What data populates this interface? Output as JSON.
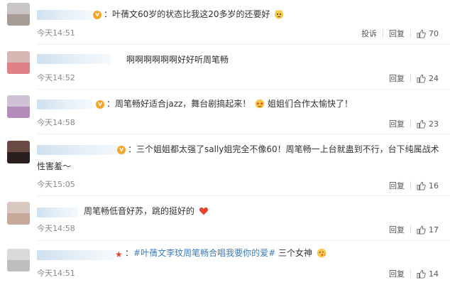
{
  "comments": [
    {
      "has_v": true,
      "text": "叶蒨文60岁的状态比我这20多岁的还要好",
      "emoji": "cat-emoji",
      "time": "今天14:51",
      "actions": [
        "投诉",
        "回复"
      ],
      "likes": "70"
    },
    {
      "has_v": false,
      "text": "啊啊啊啊啊啊好好听周笔畅",
      "time": "今天14:52",
      "actions": [
        "回复"
      ],
      "likes": "24"
    },
    {
      "has_v": true,
      "text": "周笔畅好适合jazz，舞台剧搞起来！",
      "text2": "姐姐们合作太愉快了！",
      "emoji": "star-eyes-emoji",
      "time": "今天14:58",
      "actions": [
        "回复"
      ],
      "likes": "23"
    },
    {
      "has_v": true,
      "text": "三个姐姐都太强了sally姐完全不像60！周笔畅一上台就蛊到不行，台下纯属战术",
      "text_line2": "性害羞～",
      "time": "今天15:05",
      "actions": [
        "回复"
      ],
      "likes": "16"
    },
    {
      "has_v": false,
      "text": "周笔畅低音好苏，跳的挺好的",
      "emoji": "heart-emoji",
      "time": "今天14:58",
      "actions": [
        "回复"
      ],
      "likes": "17"
    },
    {
      "has_v": false,
      "hashtag": "#叶蒨文李玟周笔畅合唱我要你的爱#",
      "text": "三个女神",
      "emoji": "kiss-emoji",
      "time": "今天14:51",
      "actions": [
        "回复"
      ],
      "likes": "14"
    }
  ],
  "colors": {
    "link": "#3f7cbc",
    "vip": "#f6a623",
    "time": "#8a8a8a"
  }
}
